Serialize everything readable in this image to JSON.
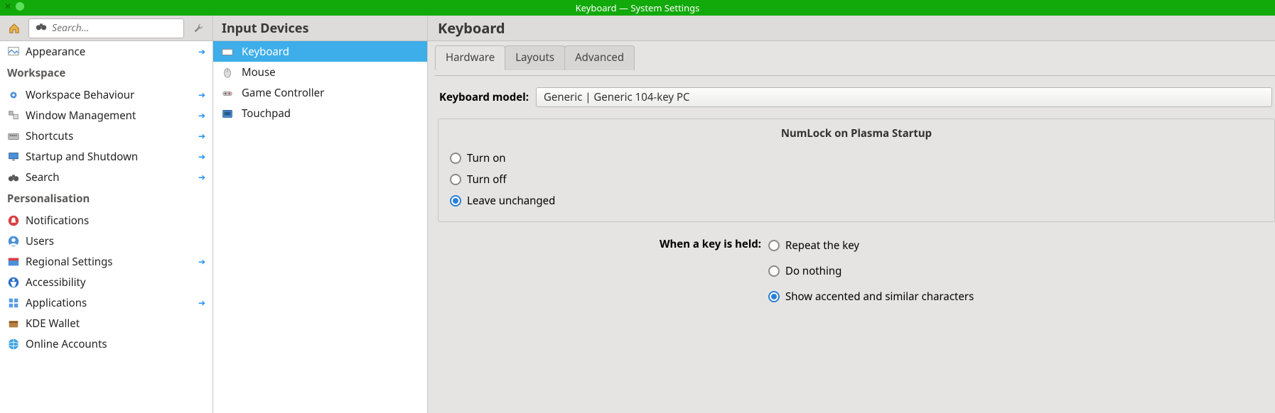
{
  "window_title": "Keyboard — System Settings",
  "toolbar": {
    "search_placeholder": "Search..."
  },
  "sidebar": {
    "top_item": {
      "label": "Appearance"
    },
    "groups": [
      {
        "header": "Workspace",
        "items": [
          {
            "label": "Workspace Behaviour",
            "arrow": true,
            "icon": "gear"
          },
          {
            "label": "Window Management",
            "arrow": true,
            "icon": "windows"
          },
          {
            "label": "Shortcuts",
            "arrow": true,
            "icon": "keyboard"
          },
          {
            "label": "Startup and Shutdown",
            "arrow": true,
            "icon": "monitor"
          },
          {
            "label": "Search",
            "arrow": true,
            "icon": "binoculars"
          }
        ]
      },
      {
        "header": "Personalisation",
        "items": [
          {
            "label": "Notifications",
            "arrow": false,
            "icon": "bell-red"
          },
          {
            "label": "Users",
            "arrow": false,
            "icon": "user-blue"
          },
          {
            "label": "Regional Settings",
            "arrow": true,
            "icon": "flag"
          },
          {
            "label": "Accessibility",
            "arrow": false,
            "icon": "access"
          },
          {
            "label": "Applications",
            "arrow": true,
            "icon": "grid"
          },
          {
            "label": "KDE Wallet",
            "arrow": false,
            "icon": "wallet"
          },
          {
            "label": "Online Accounts",
            "arrow": false,
            "icon": "globe"
          }
        ]
      }
    ]
  },
  "middle": {
    "title": "Input Devices",
    "items": [
      {
        "label": "Keyboard",
        "icon": "keyboard",
        "active": true
      },
      {
        "label": "Mouse",
        "icon": "mouse",
        "active": false
      },
      {
        "label": "Game Controller",
        "icon": "gamepad",
        "active": false
      },
      {
        "label": "Touchpad",
        "icon": "touchpad",
        "active": false
      }
    ]
  },
  "main": {
    "title": "Keyboard",
    "tabs": [
      {
        "label": "Hardware",
        "active": true
      },
      {
        "label": "Layouts",
        "active": false
      },
      {
        "label": "Advanced",
        "active": false
      }
    ],
    "model_label": "Keyboard model:",
    "model_value": "Generic | Generic 104-key PC",
    "numlock": {
      "title": "NumLock on Plasma Startup",
      "options": [
        {
          "label": "Turn on",
          "checked": false
        },
        {
          "label": "Turn off",
          "checked": false
        },
        {
          "label": "Leave unchanged",
          "checked": true
        }
      ]
    },
    "held": {
      "label": "When a key is held:",
      "options": [
        {
          "label": "Repeat the key",
          "checked": false
        },
        {
          "label": "Do nothing",
          "checked": false
        },
        {
          "label": "Show accented and similar characters",
          "checked": true
        }
      ]
    }
  }
}
